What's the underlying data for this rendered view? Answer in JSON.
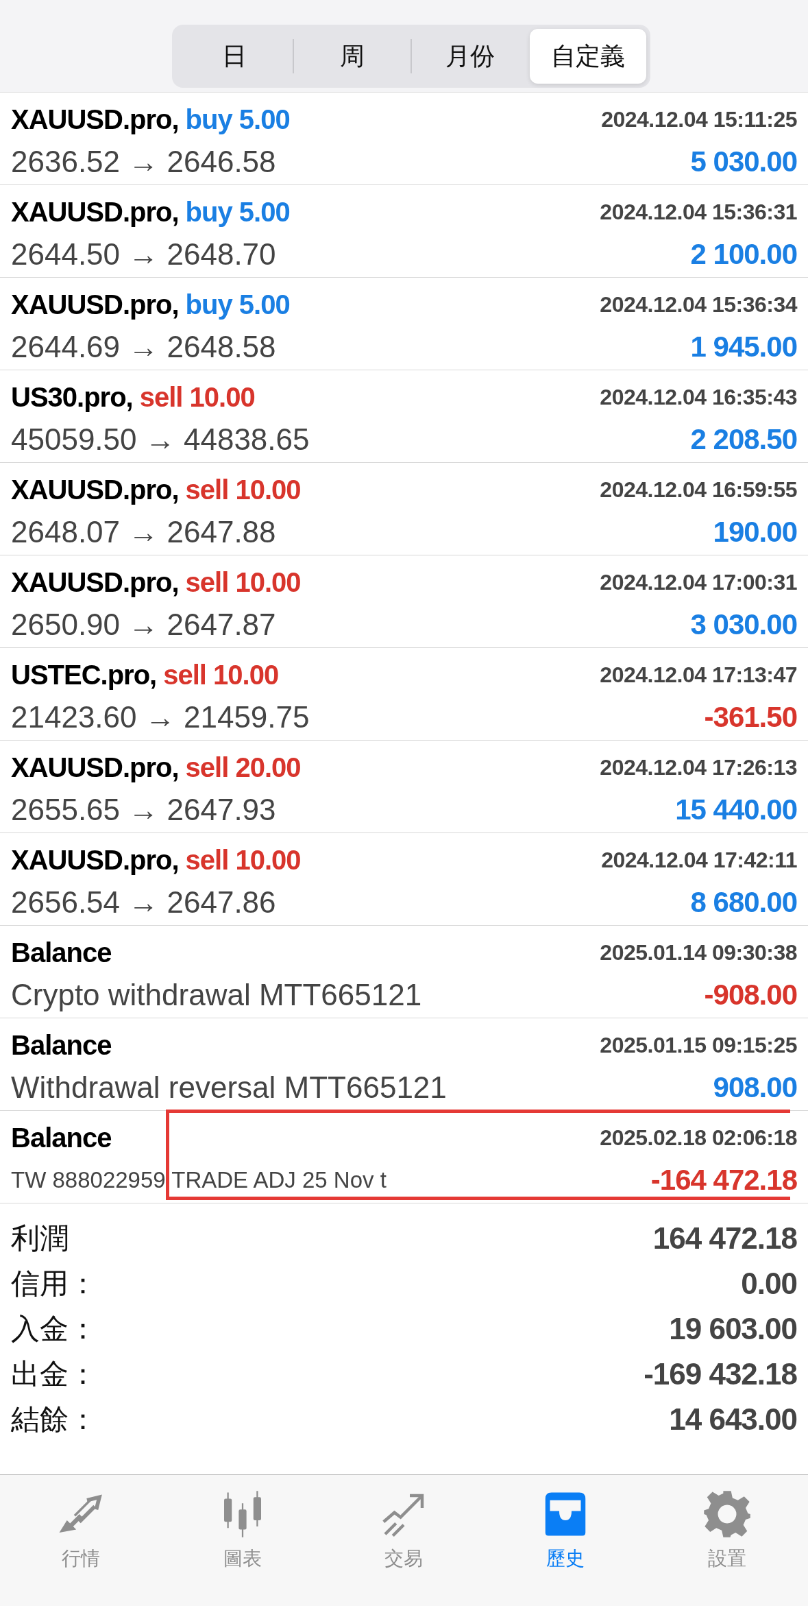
{
  "segments": [
    {
      "label": "日",
      "selected": false
    },
    {
      "label": "周",
      "selected": false
    },
    {
      "label": "月份",
      "selected": false
    },
    {
      "label": "自定義",
      "selected": true
    }
  ],
  "rows": [
    {
      "kind": "buy",
      "title": "XAUUSD.pro,",
      "action": "buy 5.00",
      "time": "2024.12.04 15:11:25",
      "detail": "2636.52 → 2646.58",
      "amount": "5 030.00",
      "negative": false,
      "highlighted": false
    },
    {
      "kind": "buy",
      "title": "XAUUSD.pro,",
      "action": "buy 5.00",
      "time": "2024.12.04 15:36:31",
      "detail": "2644.50 → 2648.70",
      "amount": "2 100.00",
      "negative": false,
      "highlighted": false
    },
    {
      "kind": "buy",
      "title": "XAUUSD.pro,",
      "action": "buy 5.00",
      "time": "2024.12.04 15:36:34",
      "detail": "2644.69 → 2648.58",
      "amount": "1 945.00",
      "negative": false,
      "highlighted": false
    },
    {
      "kind": "sell",
      "title": "US30.pro,",
      "action": "sell 10.00",
      "time": "2024.12.04 16:35:43",
      "detail": "45059.50 → 44838.65",
      "amount": "2 208.50",
      "negative": false,
      "highlighted": false
    },
    {
      "kind": "sell",
      "title": "XAUUSD.pro,",
      "action": "sell 10.00",
      "time": "2024.12.04 16:59:55",
      "detail": "2648.07 → 2647.88",
      "amount": "190.00",
      "negative": false,
      "highlighted": false
    },
    {
      "kind": "sell",
      "title": "XAUUSD.pro,",
      "action": "sell 10.00",
      "time": "2024.12.04 17:00:31",
      "detail": "2650.90 → 2647.87",
      "amount": "3 030.00",
      "negative": false,
      "highlighted": false
    },
    {
      "kind": "sell",
      "title": "USTEC.pro,",
      "action": "sell 10.00",
      "time": "2024.12.04 17:13:47",
      "detail": "21423.60 → 21459.75",
      "amount": "-361.50",
      "negative": true,
      "highlighted": false
    },
    {
      "kind": "sell",
      "title": "XAUUSD.pro,",
      "action": "sell 20.00",
      "time": "2024.12.04 17:26:13",
      "detail": "2655.65 → 2647.93",
      "amount": "15 440.00",
      "negative": false,
      "highlighted": false
    },
    {
      "kind": "sell",
      "title": "XAUUSD.pro,",
      "action": "sell 10.00",
      "time": "2024.12.04 17:42:11",
      "detail": "2656.54 → 2647.86",
      "amount": "8 680.00",
      "negative": false,
      "highlighted": false
    },
    {
      "kind": "balance",
      "title": "Balance",
      "time": "2025.01.14 09:30:38",
      "detail": "Crypto withdrawal MTT665121",
      "amount": "-908.00",
      "negative": true,
      "highlighted": false
    },
    {
      "kind": "balance",
      "title": "Balance",
      "time": "2025.01.15 09:15:25",
      "detail": "Withdrawal reversal MTT665121",
      "amount": "908.00",
      "negative": false,
      "highlighted": false
    },
    {
      "kind": "balance",
      "title": "Balance",
      "time": "2025.02.18 02:06:18",
      "detail": "TW 888022959 TRADE ADJ 25 Nov t",
      "amount": "-164 472.18",
      "negative": true,
      "highlighted": true
    }
  ],
  "summary": [
    {
      "label": "利潤",
      "value": "164 472.18"
    },
    {
      "label": "信用：",
      "value": "0.00"
    },
    {
      "label": "入金：",
      "value": "19 603.00"
    },
    {
      "label": "出金：",
      "value": "-169 432.18"
    },
    {
      "label": "結餘：",
      "value": "14 643.00"
    }
  ],
  "tabs": [
    {
      "kind": "quotes",
      "label": "行情",
      "selected": false
    },
    {
      "kind": "chart",
      "label": "圖表",
      "selected": false
    },
    {
      "kind": "trade",
      "label": "交易",
      "selected": false
    },
    {
      "kind": "history",
      "label": "歷史",
      "selected": true
    },
    {
      "kind": "settings",
      "label": "設置",
      "selected": false
    }
  ]
}
